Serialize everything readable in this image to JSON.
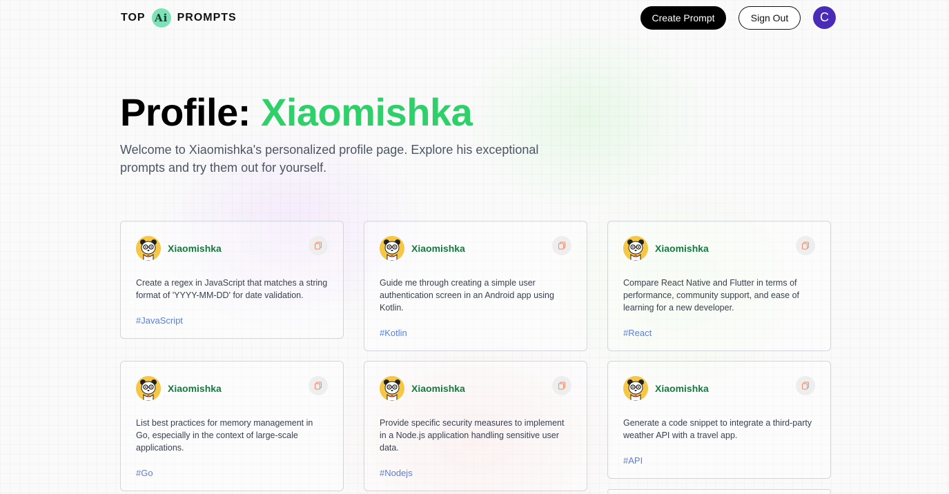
{
  "header": {
    "logo_left": "TOP",
    "logo_badge": "Ai",
    "logo_right": "PROMPTS",
    "create_label": "Create Prompt",
    "signout_label": "Sign Out",
    "user_initial": "C"
  },
  "hero": {
    "title_prefix": "Profile:",
    "title_name": "Xiaomishka",
    "description": "Welcome to Xiaomishka's personalized profile page. Explore his exceptional prompts and try them out for yourself."
  },
  "colors": {
    "accent_green": "#2fd06a",
    "username_green": "#157a40",
    "tag_blue": "#5b7ed6",
    "user_avatar": "#4a2ab8"
  },
  "cards": [
    {
      "user": "Xiaomishka",
      "text": "Create a regex in JavaScript that matches a string format of 'YYYY-MM-DD' for date validation.",
      "tag": "#JavaScript",
      "icon": "copy-icon"
    },
    {
      "user": "Xiaomishka",
      "text": "Guide me through creating a simple user authentication screen in an Android app using Kotlin.",
      "tag": "#Kotlin",
      "icon": "copy-icon"
    },
    {
      "user": "Xiaomishka",
      "text": "Compare React Native and Flutter in terms of performance, community support, and ease of learning for a new developer.",
      "tag": "#React",
      "icon": "copy-icon"
    },
    {
      "user": "Xiaomishka",
      "text": "List best practices for memory management in Go, especially in the context of large-scale applications.",
      "tag": "#Go",
      "icon": "copy-icon"
    },
    {
      "user": "Xiaomishka",
      "text": "Provide specific security measures to implement in a Node.js application handling sensitive user data.",
      "tag": "#Nodejs",
      "icon": "copy-icon"
    },
    {
      "user": "Xiaomishka",
      "text": "Generate a code snippet to integrate a third-party weather API with a travel app.",
      "tag": "#API",
      "icon": "copy-icon"
    }
  ]
}
